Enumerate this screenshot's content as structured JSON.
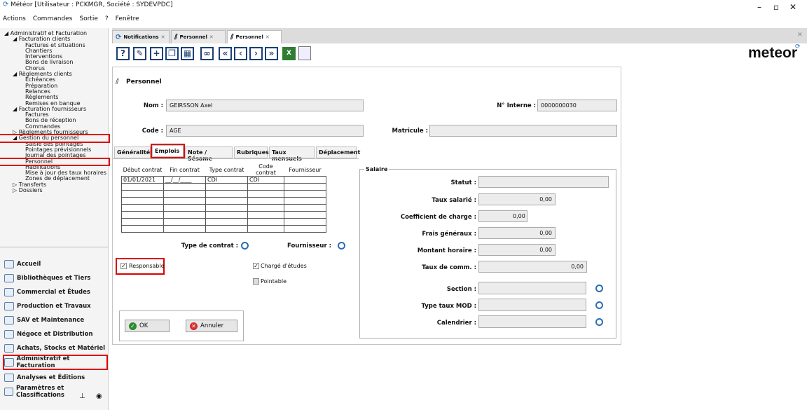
{
  "window": {
    "title": "Météor [Utilisateur : PCKMGR, Société : SYDEVPDC]",
    "brand": "meteor"
  },
  "menu": [
    "Actions",
    "Commandes",
    "Sortie",
    "?",
    "Fenêtre"
  ],
  "tree": [
    {
      "l": 0,
      "t": "◢ Administratif et Facturation"
    },
    {
      "l": 1,
      "t": "◢ Facturation clients"
    },
    {
      "l": 2,
      "t": "Factures et situations"
    },
    {
      "l": 2,
      "t": "Chantiers"
    },
    {
      "l": 2,
      "t": "Interventions"
    },
    {
      "l": 2,
      "t": "Bons de livraison"
    },
    {
      "l": 2,
      "t": "Chorus"
    },
    {
      "l": 1,
      "t": "◢ Règlements clients"
    },
    {
      "l": 2,
      "t": "Échéances"
    },
    {
      "l": 2,
      "t": "Préparation"
    },
    {
      "l": 2,
      "t": "Relances"
    },
    {
      "l": 2,
      "t": "Règlements"
    },
    {
      "l": 2,
      "t": "Remises en banque"
    },
    {
      "l": 1,
      "t": "◢ Facturation fournisseurs"
    },
    {
      "l": 2,
      "t": "Factures"
    },
    {
      "l": 2,
      "t": "Bons de réception"
    },
    {
      "l": 2,
      "t": "Commandes"
    },
    {
      "l": 1,
      "t": "▷ Règlements fournisseurs"
    },
    {
      "l": 1,
      "t": "◢ Gestion du personnel",
      "hl": true
    },
    {
      "l": 2,
      "t": "Saisie des pointages"
    },
    {
      "l": 2,
      "t": "Pointages prévisionnels"
    },
    {
      "l": 2,
      "t": "Journal des pointages"
    },
    {
      "l": 2,
      "t": "Personnel",
      "hl": true
    },
    {
      "l": 2,
      "t": "Habilitations"
    },
    {
      "l": 2,
      "t": "Mise à jour des taux horaires"
    },
    {
      "l": 2,
      "t": "Zones de déplacement"
    },
    {
      "l": 1,
      "t": "▷ Transferts"
    },
    {
      "l": 1,
      "t": "▷ Dossiers"
    }
  ],
  "nav": [
    "Accueil",
    "Bibliothèques et Tiers",
    "Commercial et Études",
    "Production et Travaux",
    "SAV et Maintenance",
    "Négoce et Distribution",
    "Achats, Stocks et Matériel",
    "Administratif et Facturation",
    "Analyses et Éditions",
    "Paramètres et Classifications"
  ],
  "tabs": [
    "Notifications",
    "Personnel",
    "Personnel"
  ],
  "form": {
    "section_title": "Personnel",
    "nom_label": "Nom :",
    "nom_value": "GEIRSSON Axel",
    "interne_label": "N° Interne :",
    "interne_value": "0000000030",
    "code_label": "Code :",
    "code_value": "AGE",
    "matricule_label": "Matricule :",
    "matricule_value": "",
    "subtabs": [
      "Généralités",
      "Emplois",
      "Note / Sésame",
      "Rubriques",
      "Taux mensuels",
      "Déplacement"
    ],
    "grid_headers": [
      "Début contrat",
      "Fin contrat",
      "Type contrat",
      "Code contrat",
      "Fournisseur"
    ],
    "grid_row": [
      "01/01/2021",
      "__/__/____",
      "CDI",
      "CDI",
      ""
    ],
    "type_contrat_label": "Type de contrat :",
    "fournisseur_label": "Fournisseur :",
    "responsable": "Responsable",
    "charge_etudes": "Chargé d'études",
    "pointable": "Pointable",
    "ok": "OK",
    "annuler": "Annuler",
    "salaire": "Salaire",
    "statut": "Statut :",
    "taux_salarie": "Taux salarié :",
    "taux_salarie_v": "0,00",
    "coef": "Coefficient de charge :",
    "coef_v": "0,00",
    "frais": "Frais généraux :",
    "frais_v": "0,00",
    "montant": "Montant horaire :",
    "montant_v": "0,00",
    "taux_comm": "Taux de comm. :",
    "taux_comm_v": "0,00",
    "section": "Section :",
    "taux_mod": "Type taux MOD :",
    "calendrier": "Calendrier :"
  }
}
